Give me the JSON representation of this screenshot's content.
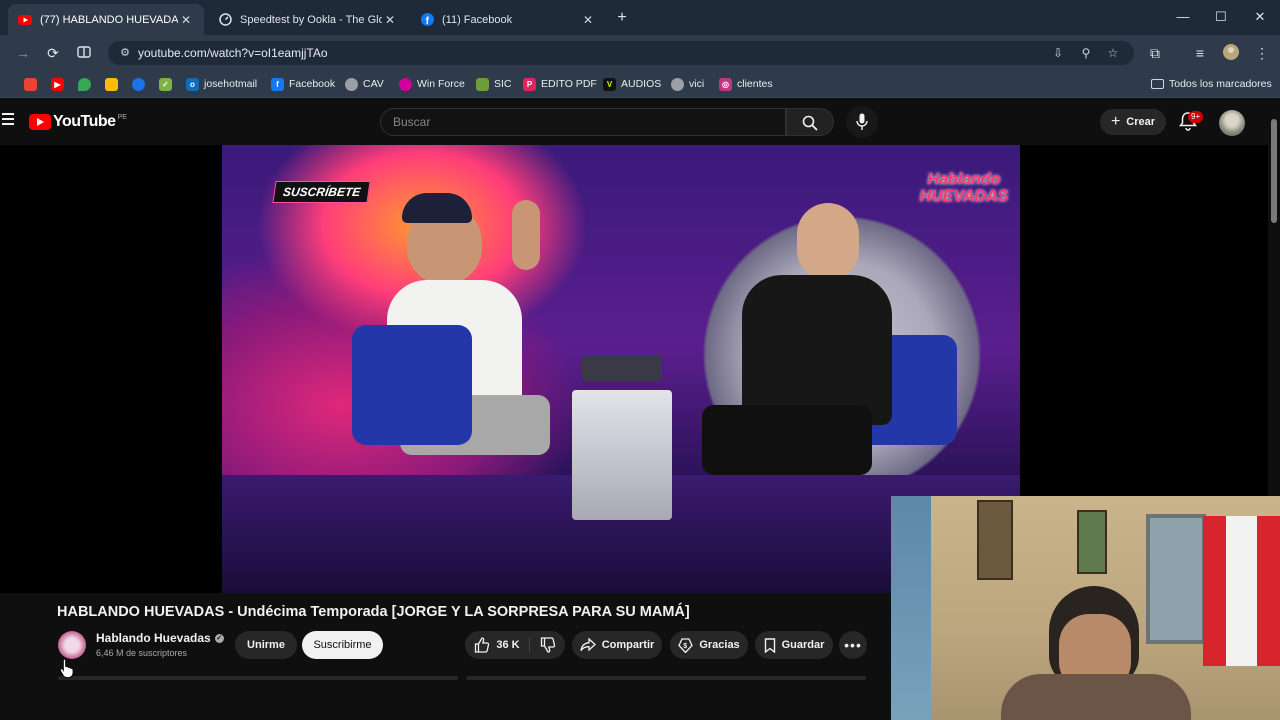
{
  "browser": {
    "tabs": [
      {
        "title": "(77) HABLANDO HUEVADAS - Und",
        "favicon": "youtube-icon",
        "active": true
      },
      {
        "title": "Speedtest by Ookla - The Global",
        "favicon": "speedtest-icon",
        "active": false
      },
      {
        "title": "(11) Facebook",
        "favicon": "facebook-icon",
        "active": false
      }
    ],
    "url": "youtube.com/watch?v=oI1eamjjTAo",
    "bookmarks": [
      {
        "label": "",
        "icon": "google-maps-icon",
        "color": "#ea4335"
      },
      {
        "label": "",
        "icon": "youtube-icon",
        "color": "#ff0000"
      },
      {
        "label": "",
        "icon": "maps-pin-icon",
        "color": "#34a853"
      },
      {
        "label": "",
        "icon": "pinwheel-icon",
        "color": "#fbbc05"
      },
      {
        "label": "",
        "icon": "globe-icon",
        "color": "#1a73e8"
      },
      {
        "label": "",
        "icon": "check-icon",
        "color": "#7cb342"
      },
      {
        "label": "josehotmail",
        "icon": "outlook-icon",
        "color": "#0f6cbd"
      },
      {
        "label": "Facebook",
        "icon": "facebook-icon",
        "color": "#1877f2"
      },
      {
        "label": "CAV",
        "icon": "globe-icon",
        "color": "#9aa0a6"
      },
      {
        "label": "Win Force",
        "icon": "winforce-icon",
        "color": "#d1009a"
      },
      {
        "label": "SIC",
        "icon": "sic-icon",
        "color": "#6d9e3a"
      },
      {
        "label": "EDITO PDF",
        "icon": "pdf-icon",
        "color": "#e0245e"
      },
      {
        "label": "AUDIOS",
        "icon": "v-icon",
        "color": "#111111"
      },
      {
        "label": "vici",
        "icon": "globe-icon",
        "color": "#9aa0a6"
      },
      {
        "label": "clientes",
        "icon": "instagram-icon",
        "color": "#c13584"
      }
    ],
    "all_bookmarks_label": "Todos los marcadores"
  },
  "youtube": {
    "logo_text": "YouTube",
    "country_code": "PE",
    "search_placeholder": "Buscar",
    "create_label": "Crear",
    "notification_badge": "9+"
  },
  "video": {
    "overlay_subscribe": "SUSCRÍBETE",
    "overlay_show_logo": "Hablando HUEVADAS",
    "title": "HABLANDO HUEVADAS - Undécima Temporada [JORGE Y LA SORPRESA PARA SU MAMÁ]",
    "channel_name": "Hablando Huevadas",
    "subscribers": "6,46 M de suscriptores",
    "join_label": "Unirme",
    "subscribe_label": "Suscribirme",
    "likes": "36 K",
    "share_label": "Compartir",
    "thanks_label": "Gracias",
    "save_label": "Guardar"
  },
  "colors": {
    "youtube_red": "#ff0000",
    "page_bg": "#0f0f0f",
    "chrome_tab_bg": "#1f2a38",
    "chrome_toolbar_bg": "#2f3b4a"
  }
}
